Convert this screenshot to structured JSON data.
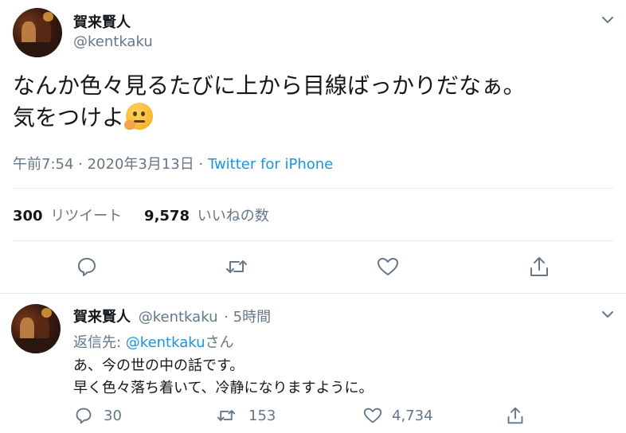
{
  "main_tweet": {
    "author_name": "賀来賢人",
    "author_handle": "@kentkaku",
    "text_line1": "なんか色々見るたびに上から目線ばっかりだなぁ。",
    "text_line2": "気をつけよ",
    "emoji_icon": "thinking-face-icon",
    "timestamp": "午前7:54 · 2020年3月13日",
    "source_separator": " · ",
    "source": "Twitter for iPhone",
    "retweets_count": "300",
    "retweets_label": "リツイート",
    "likes_count": "9,578",
    "likes_label": "いいねの数"
  },
  "reply_tweet": {
    "author_name": "賀来賢人",
    "author_handle": "@kentkaku",
    "time": "· 5時間",
    "reply_to_prefix": "返信先: ",
    "reply_to_handle": "@kentkaku",
    "reply_to_suffix": "さん",
    "text_line1": "あ、今の世の中の話です。",
    "text_line2": "早く色々落ち着いて、冷静になりますように。",
    "reply_count": "30",
    "retweet_count": "153",
    "like_count": "4,734"
  },
  "colors": {
    "accent": "#1b95e0",
    "secondary_text": "#657786",
    "divider": "#e6ecf0"
  }
}
